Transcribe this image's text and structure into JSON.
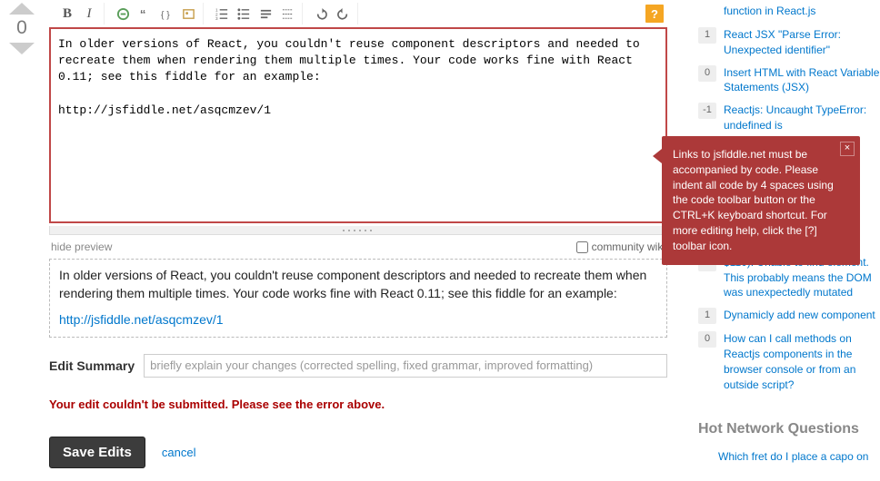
{
  "vote": {
    "score": "0"
  },
  "editor": {
    "content": "In older versions of React, you couldn't reuse component descriptors and needed to recreate them when rendering them multiple times. Your code works fine with React 0.11; see this fiddle for an example:\n\nhttp://jsfiddle.net/asqcmzev/1"
  },
  "preview_bar": {
    "hide_preview": "hide preview",
    "community_wiki": "community wiki"
  },
  "preview": {
    "text": "In older versions of React, you couldn't reuse component descriptors and needed to recreate them when rendering them multiple times. Your code works fine with React 0.11; see this fiddle for an example:",
    "link": "http://jsfiddle.net/asqcmzev/1"
  },
  "edit_summary": {
    "label": "Edit Summary",
    "placeholder": "briefly explain your changes (corrected spelling, fixed grammar, improved formatting)"
  },
  "error": "Your edit couldn't be submitted. Please see the error above.",
  "actions": {
    "save": "Save Edits",
    "cancel": "cancel"
  },
  "tooltip": {
    "text": "Links to jsfiddle.net must be accompanied by code. Please indent all code by 4 spaces using the code toolbar button or the CTRL+K keyboard shortcut. For more editing help, click the [?] toolbar icon.",
    "close": "×"
  },
  "related": [
    {
      "score": "",
      "text": "function in React.js"
    },
    {
      "score": "1",
      "text": "React JSX \"Parse Error: Unexpected identifier\""
    },
    {
      "score": "0",
      "text": "Insert HTML with React Variable Statements (JSX)"
    },
    {
      "score": "-1",
      "text": "Reactjs: Uncaught TypeError: undefined is"
    },
    {
      "score": "0",
      "text": "$110): Unable to find element. This probably means the DOM was unexpectedly mutated"
    },
    {
      "score": "1",
      "text": "Dynamicly add new component"
    },
    {
      "score": "0",
      "text": "How can I call methods on Reactjs components in the browser console or from an outside script?"
    }
  ],
  "hot": {
    "header": "Hot Network Questions",
    "item": "Which fret do I place a capo on"
  }
}
